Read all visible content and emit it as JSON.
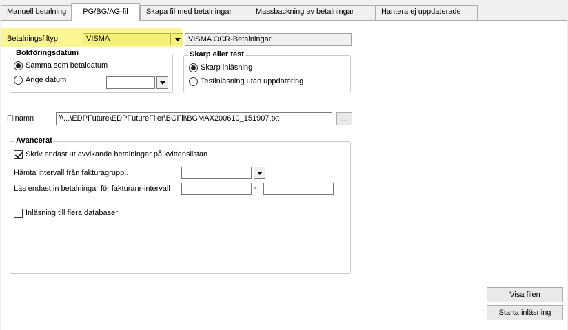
{
  "tabs": [
    {
      "label": "Manuell betalning",
      "active": false
    },
    {
      "label": "PG/BG/AG-fil",
      "active": true
    },
    {
      "label": "Skapa fil med betalningar",
      "active": false
    },
    {
      "label": "Massbackning av betalningar",
      "active": false
    },
    {
      "label": "Hantera ej uppdaterade",
      "active": false
    }
  ],
  "filetype": {
    "label": "Betalningsfiltyp",
    "value": "VISMA",
    "description": "VISMA OCR-Betalningar",
    "highlight_color": "#faf693"
  },
  "bokforing": {
    "title": "Bokföringsdatum",
    "option_same": "Samma som betaldatum",
    "option_date": "Ange datum",
    "selected": "option_same",
    "date_value": ""
  },
  "skarp": {
    "title": "Skarp eller test",
    "option_skarp": "Skarp inläsning",
    "option_test": "Testinläsning utan uppdatering",
    "selected": "option_skarp"
  },
  "file": {
    "label": "Filnamn",
    "value": "\\\\...\\EDPFuture\\EDPFutureFiler\\BGFil\\BGMAX200610_151907.txt",
    "browse_label": "..."
  },
  "advanced": {
    "title": "Avancerat",
    "only_deviating_label": "Skriv endast ut avvikande betalningar på kvittenslistan",
    "only_deviating_checked": true,
    "interval_group_label": "Hämta intervall från fakturagrupp..",
    "interval_group_value": "",
    "invoice_range_label": "Läs endast in betalningar för fakturanr-intervall",
    "invoice_from": "",
    "range_separator": "-",
    "invoice_to": "",
    "multi_db_label": "Inläsning till flera databaser",
    "multi_db_checked": false
  },
  "buttons": {
    "show_file": "Visa filen",
    "start_import": "Starta inläsning"
  }
}
